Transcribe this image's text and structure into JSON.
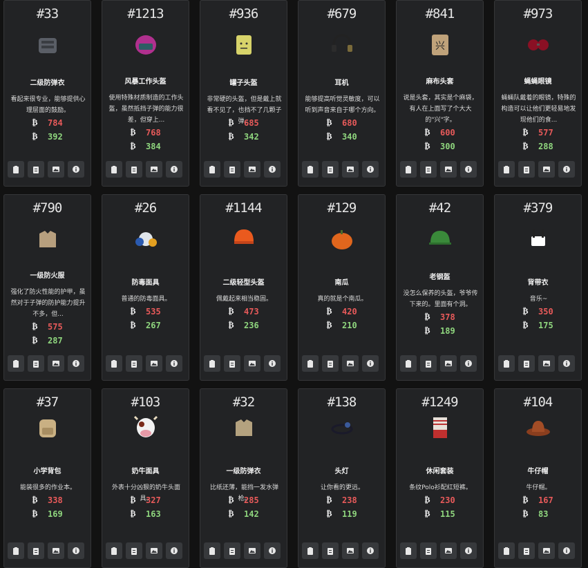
{
  "items": [
    {
      "id": "#33",
      "name": "二级防弹衣",
      "desc": "看起来很专业，能够提供心理层面的鼓励。",
      "buy": "784",
      "sell": "392",
      "icon": "body-armor-icon"
    },
    {
      "id": "#1213",
      "name": "风暴工作头盔",
      "desc": "使用特殊材质制造的工作头盔，虽然抵挡子弹的能力很差，但穿上...",
      "buy": "768",
      "sell": "384",
      "icon": "storm-helmet-icon"
    },
    {
      "id": "#936",
      "name": "罐子头盔",
      "desc": "非常硬的头盔，但是戴上就看不见了，也挡不了几颗子弹。",
      "buy": "685",
      "sell": "342",
      "icon": "can-helmet-icon"
    },
    {
      "id": "#679",
      "name": "耳机",
      "desc": "能够提高听觉灵敏度，可以听到声音来自于哪个方向。",
      "buy": "680",
      "sell": "340",
      "icon": "headset-icon"
    },
    {
      "id": "#841",
      "name": "麻布头套",
      "desc": "说是头套，其实是个麻袋，有人在上面写了个大大的\"兴\"字。",
      "buy": "600",
      "sell": "300",
      "icon": "burlap-sack-icon"
    },
    {
      "id": "#973",
      "name": "蝇蝇眼镜",
      "desc": "蝇蝇队戴着的眼镜，特殊的构造可以让他们更轻易地发现他们的食...",
      "buy": "577",
      "sell": "288",
      "icon": "fly-goggles-icon"
    },
    {
      "id": "#790",
      "name": "一级防火服",
      "desc": "强化了防火性能的护甲，虽然对于子弹的防护能力提升不多，但...",
      "buy": "575",
      "sell": "287",
      "icon": "fire-vest-icon"
    },
    {
      "id": "#26",
      "name": "防毒面具",
      "desc": "普通的防毒面具。",
      "buy": "535",
      "sell": "267",
      "icon": "gas-mask-icon"
    },
    {
      "id": "#1144",
      "name": "二级轻型头盔",
      "desc": "佩戴起来相当稳固。",
      "buy": "473",
      "sell": "236",
      "icon": "light-helmet-icon"
    },
    {
      "id": "#129",
      "name": "南瓜",
      "desc": "真的就是个南瓜。",
      "buy": "420",
      "sell": "210",
      "icon": "pumpkin-icon"
    },
    {
      "id": "#42",
      "name": "老钢盔",
      "desc": "没怎么保养的头盔，爷爷传下来的。里面有个洞。",
      "buy": "378",
      "sell": "189",
      "icon": "steel-helmet-icon"
    },
    {
      "id": "#379",
      "name": "背带衣",
      "desc": "音乐~",
      "buy": "350",
      "sell": "175",
      "icon": "suspenders-icon"
    },
    {
      "id": "#37",
      "name": "小学背包",
      "desc": "能装很多的作业本。",
      "buy": "338",
      "sell": "169",
      "icon": "backpack-icon"
    },
    {
      "id": "#103",
      "name": "奶牛面具",
      "desc": "外表十分凶狠的奶牛头面具。",
      "buy": "327",
      "sell": "163",
      "icon": "cow-mask-icon"
    },
    {
      "id": "#32",
      "name": "一级防弹衣",
      "desc": "比纸还薄，能挡一发水弹枪。",
      "buy": "285",
      "sell": "142",
      "icon": "vest-icon"
    },
    {
      "id": "#138",
      "name": "头灯",
      "desc": "让你看的更远。",
      "buy": "238",
      "sell": "119",
      "icon": "headlamp-icon"
    },
    {
      "id": "#1249",
      "name": "休闲套装",
      "desc": "条纹Polo衫配红短裤。",
      "buy": "230",
      "sell": "115",
      "icon": "casual-outfit-icon"
    },
    {
      "id": "#104",
      "name": "牛仔帽",
      "desc": "牛仔帽。",
      "buy": "167",
      "sell": "83",
      "icon": "cowboy-hat-icon"
    }
  ],
  "currency_icon": "coin-icon",
  "action_icons": [
    "clipboard-icon",
    "clipboard-list-icon",
    "image-icon",
    "info-icon"
  ],
  "colors": {
    "buy": "#e85a5a",
    "sell": "#8fd67e",
    "card": "#222325",
    "background": "#121212"
  }
}
